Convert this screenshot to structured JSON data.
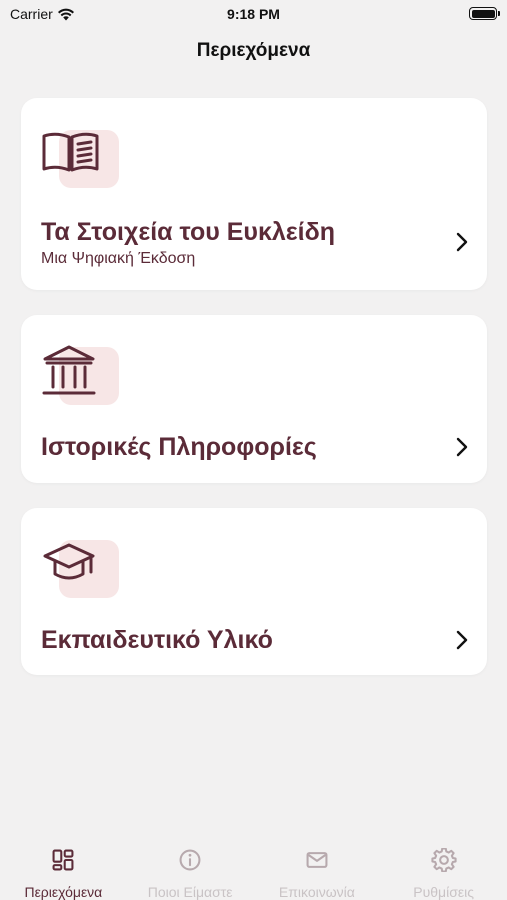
{
  "status_bar": {
    "carrier": "Carrier",
    "time": "9:18 PM"
  },
  "nav": {
    "title": "Περιεχόμενα"
  },
  "cards": [
    {
      "icon": "open-book-icon",
      "title": "Τα Στοιχεία του Ευκλείδη",
      "subtitle": "Μια Ψηφιακή Έκδοση"
    },
    {
      "icon": "museum-icon",
      "title": "Ιστορικές Πληροφορίες"
    },
    {
      "icon": "graduation-cap-icon",
      "title": "Εκπαιδευτικό Υλικό"
    }
  ],
  "tabs": [
    {
      "icon": "dashboard-icon",
      "label": "Περιεχόμενα",
      "active": true
    },
    {
      "icon": "info-icon",
      "label": "Ποιοι Είμαστε",
      "active": false
    },
    {
      "icon": "mail-icon",
      "label": "Επικοινωνία",
      "active": false
    },
    {
      "icon": "gear-icon",
      "label": "Ρυθμίσεις",
      "active": false
    }
  ],
  "colors": {
    "accent": "#5b2b38",
    "icon_bg": "#f7e6e6",
    "inactive": "#c9c3c5",
    "background": "#f2f1f1"
  }
}
